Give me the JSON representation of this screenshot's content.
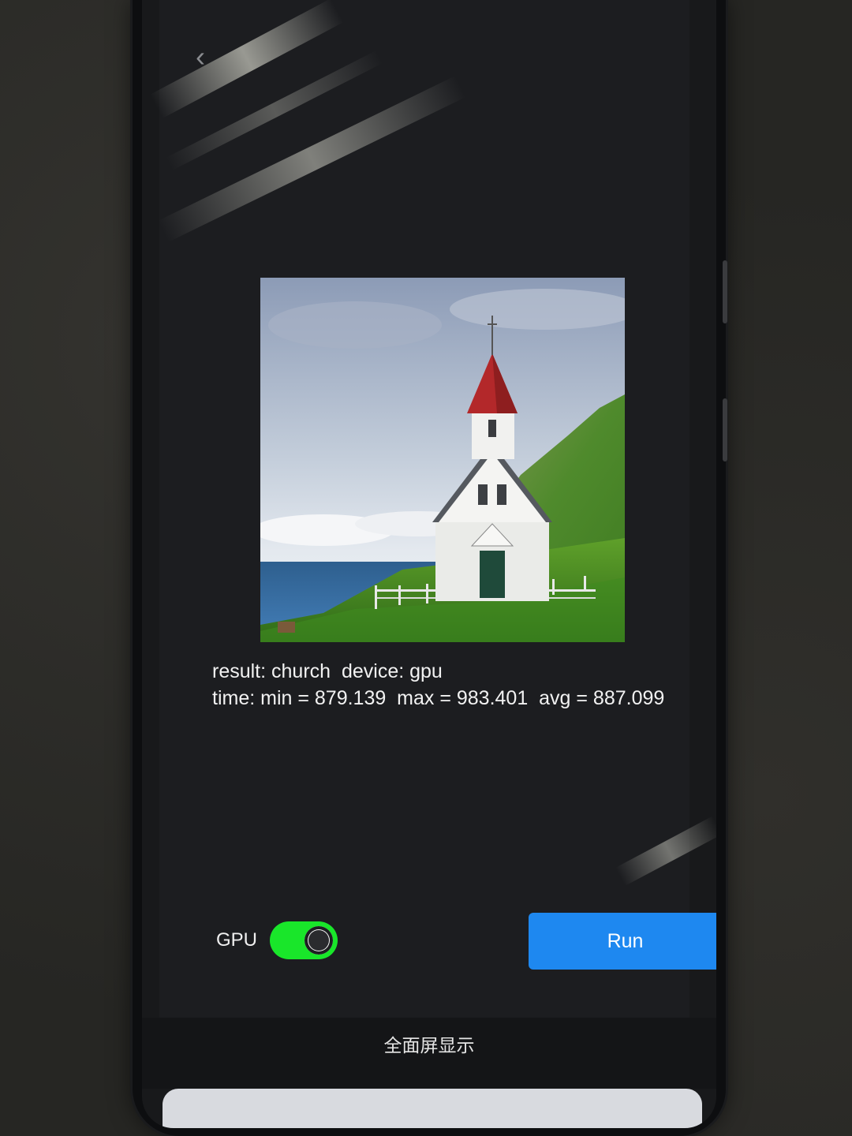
{
  "screen": {
    "result_line": "result: church  device: gpu",
    "time_line": "time: min = 879.139  max = 983.401  avg = 887.099"
  },
  "controls": {
    "gpu_label": "GPU",
    "gpu_toggle_on": true,
    "run_label": "Run"
  },
  "nav": {
    "fullscreen_label": "全面屏显示",
    "back_icon": "chevron-left-icon"
  },
  "colors": {
    "toggle_on": "#19e62a",
    "run_button": "#1e88f0"
  }
}
